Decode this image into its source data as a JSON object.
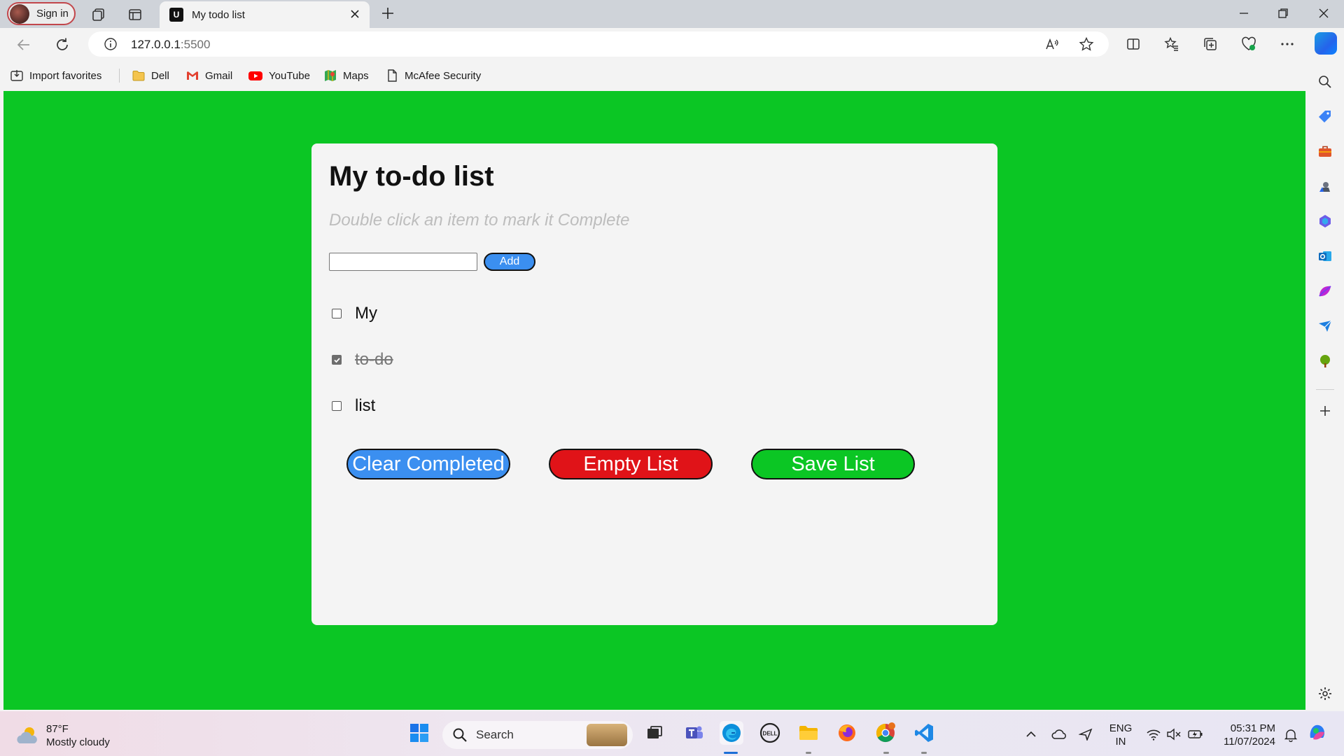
{
  "browser": {
    "profile_label": "Sign in",
    "tab": {
      "favicon_letter": "U",
      "title": "My todo list"
    },
    "url_host": "127.0.0.1",
    "url_port": ":5500"
  },
  "favorites": [
    {
      "label": "Import favorites",
      "icon": "import-icon"
    },
    {
      "label": "Dell",
      "icon": "folder-icon"
    },
    {
      "label": "Gmail",
      "icon": "gmail-icon"
    },
    {
      "label": "YouTube",
      "icon": "youtube-icon"
    },
    {
      "label": "Maps",
      "icon": "maps-icon"
    },
    {
      "label": "McAfee Security",
      "icon": "page-icon"
    }
  ],
  "page": {
    "title": "My to-do list",
    "subtitle": "Double click an item to mark it Complete",
    "input_value": "",
    "add_label": "Add",
    "items": [
      {
        "label": "My",
        "completed": false
      },
      {
        "label": "to-do",
        "completed": true
      },
      {
        "label": "list",
        "completed": false
      }
    ],
    "buttons": {
      "clear_completed": "Clear Completed",
      "empty_list": "Empty List",
      "save_list": "Save List"
    },
    "colors": {
      "background": "#0bc624",
      "card": "#f4f4f4",
      "blue_button": "#3b8ff0",
      "red_button": "#e01318",
      "green_button": "#0bc624"
    }
  },
  "taskbar": {
    "weather_temp": "87°F",
    "weather_desc": "Mostly cloudy",
    "search_label": "Search",
    "language": "ENG",
    "region": "IN",
    "time": "05:31 PM",
    "date": "11/07/2024"
  }
}
